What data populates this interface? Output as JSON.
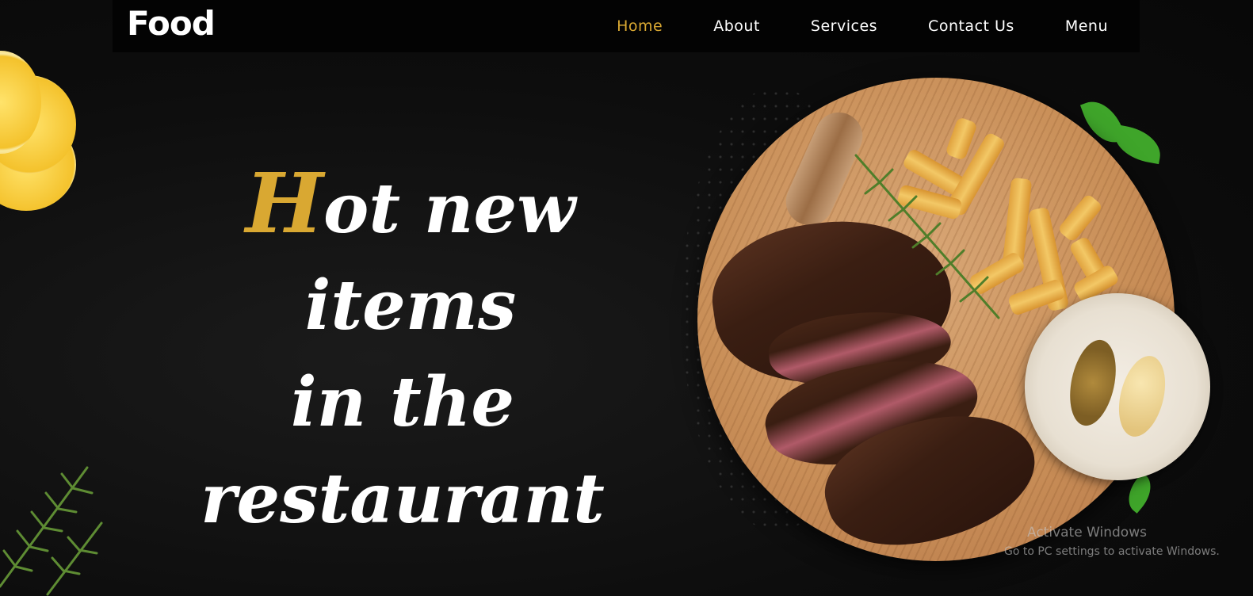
{
  "brand": {
    "logo_text": "Food"
  },
  "nav": {
    "items": [
      {
        "label": "Home",
        "active": true
      },
      {
        "label": "About",
        "active": false
      },
      {
        "label": "Services",
        "active": false
      },
      {
        "label": "Contact Us",
        "active": false
      },
      {
        "label": "Menu",
        "active": false
      }
    ]
  },
  "hero": {
    "headline_accent": "H",
    "headline_line1_rest": "ot new items",
    "headline_line2": "in the restaurant",
    "image_icon": "steak-plate-image"
  },
  "watermark": {
    "title": "Activate Windows",
    "subtitle": "Go to PC settings to activate Windows."
  },
  "colors": {
    "accent": "#d9a832",
    "background": "#0c0c0c",
    "navbar": "#030303",
    "text": "#ffffff"
  }
}
